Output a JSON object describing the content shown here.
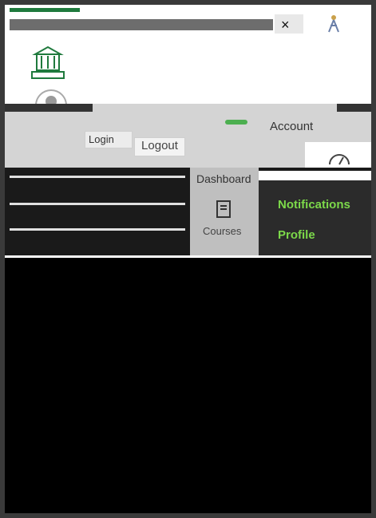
{
  "header": {
    "close_glyph": "×"
  },
  "account": {
    "login_label": "Login",
    "logout_label": "Logout",
    "account_label": "Account"
  },
  "nav": {
    "dashboard_label": "Dashboard",
    "courses_label": "Courses"
  },
  "panel": {
    "notifications_label": "Notifications",
    "profile_label": "Profile"
  },
  "icons": {
    "logo": "institution-logo-icon",
    "avatar": "user-avatar-icon",
    "courses": "book-icon",
    "gauge": "gauge-icon",
    "figure": "person-figure-icon"
  },
  "colors": {
    "brand_green": "#1f7a3d",
    "link_green": "#7cd94a"
  }
}
